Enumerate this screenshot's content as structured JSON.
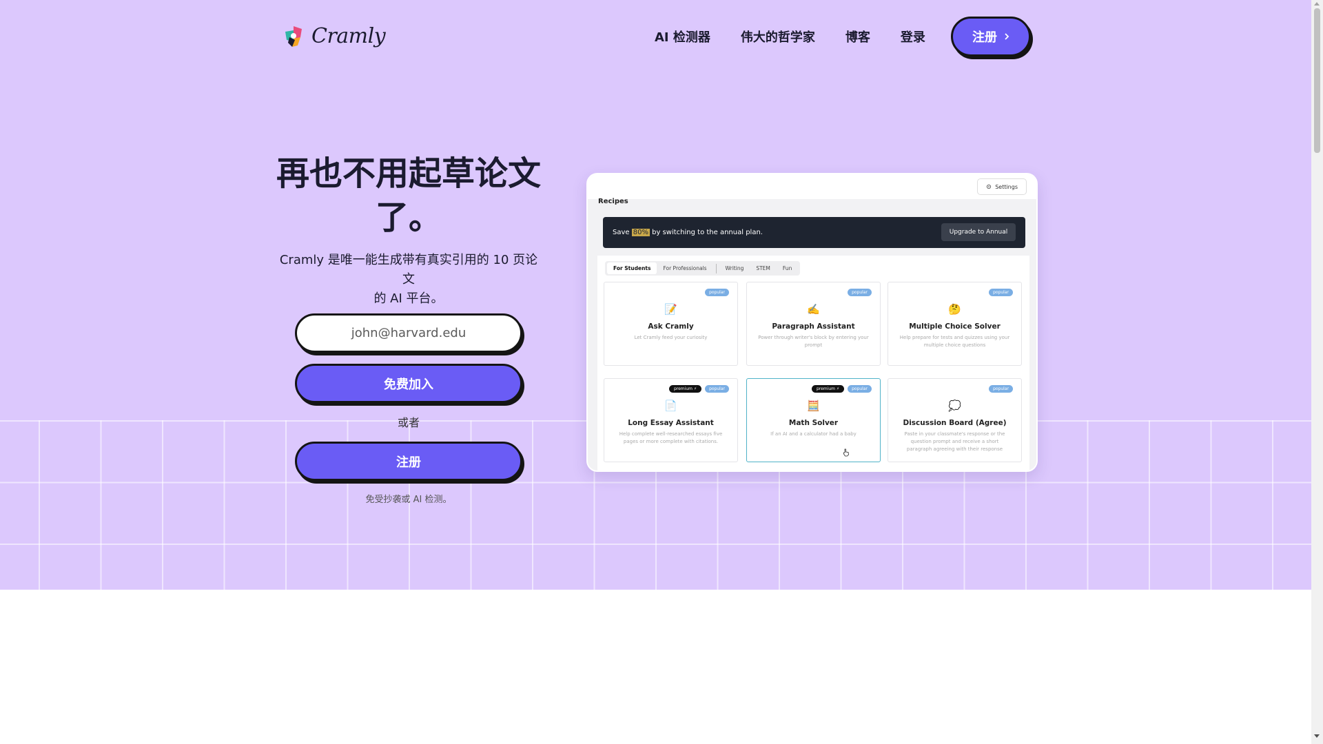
{
  "brand": {
    "name": "Cramly"
  },
  "nav": {
    "links": [
      "AI 检测器",
      "伟大的哲学家",
      "博客",
      "登录"
    ],
    "signup_label": "注册",
    "signup_icon": "chevron-right-icon"
  },
  "hero": {
    "headline_line1": "再也不用起草论文",
    "headline_line2": "了。",
    "subhead_line1": "Cramly 是唯一能生成带有真实引用的 10 页论文",
    "subhead_line2": "的 AI 平台。",
    "email_placeholder": "john@harvard.edu",
    "join_label": "免费加入",
    "or_label": "或者",
    "signup_label": "注册",
    "note": "免受抄袭或 AI 检测。"
  },
  "preview": {
    "settings_label": "Settings",
    "settings_icon": "gear-icon",
    "recipes_label": "Recipes",
    "banner_prefix": "Save ",
    "banner_highlight": "80%",
    "banner_suffix": " by switching to the annual plan.",
    "upgrade_label": "Upgrade to Annual",
    "tabs_group1": [
      "For Students",
      "For Professionals"
    ],
    "tabs_group2": [
      "Writing",
      "STEM",
      "Fun"
    ],
    "active_tab": "For Students",
    "badge_popular": "popular",
    "badge_premium": "premium ⚡",
    "cards": [
      {
        "emoji": "📝",
        "title": "Ask Cramly",
        "desc": "Let Cramly feed your curiosity",
        "premium": false
      },
      {
        "emoji": "✍️",
        "title": "Paragraph Assistant",
        "desc": "Power through writer's block by entering your prompt",
        "premium": false
      },
      {
        "emoji": "🤔",
        "title": "Multiple Choice Solver",
        "desc": "Help prepare for tests and quizzes using your multiple choice questions",
        "premium": false
      },
      {
        "emoji": "📄",
        "title": "Long Essay Assistant",
        "desc": "Help complete well-researched essays five pages or more complete with citations.",
        "premium": true
      },
      {
        "emoji": "🧮",
        "title": "Math Solver",
        "desc": "If an AI and a calculator had a baby",
        "premium": true
      },
      {
        "emoji": "💭",
        "title": "Discussion Board (Agree)",
        "desc": "Paste in your classmate's response or the question prompt and receive a short paragraph agreeing with their response",
        "premium": false
      }
    ]
  },
  "colors": {
    "hero_bg": "#dcc8fd",
    "accent": "#6a5cf5",
    "outline": "#141414",
    "badge_popular": "#7aaee4"
  }
}
